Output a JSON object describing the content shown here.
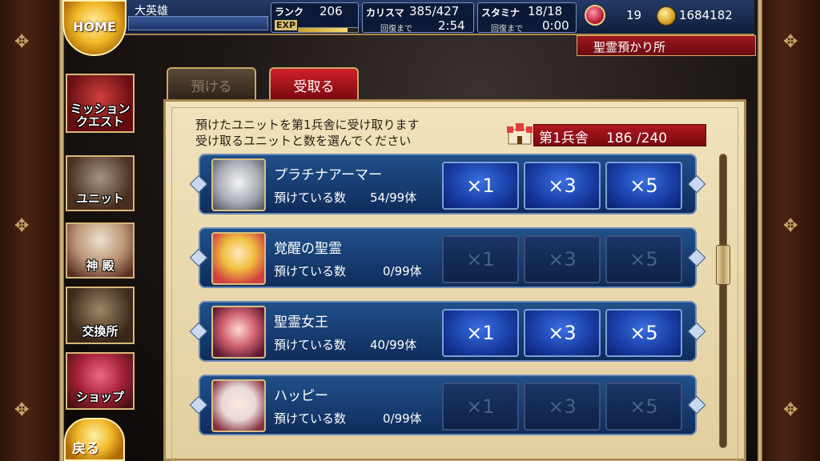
{
  "hud": {
    "player_name": "大英雄",
    "rank_label": "ランク",
    "rank_value": "206",
    "exp_label": "EXP",
    "exp_fraction": 0.82,
    "charisma_label": "カリスマ",
    "charisma_value": "385/427",
    "charisma_recover_label": "回復まで",
    "charisma_recover_time": "2:54",
    "stamina_label": "スタミナ",
    "stamina_value": "18/18",
    "stamina_recover_label": "回復まで",
    "stamina_recover_time": "0:00",
    "gem_count": "19",
    "gold_count": "1684182"
  },
  "location": "聖霊預かり所",
  "home_label": "HOME",
  "side_menu": [
    {
      "label": "ミッション\nクエスト",
      "icon": "crossed-swords-icon"
    },
    {
      "label": "ユニット",
      "icon": "knight-icon"
    },
    {
      "label": "神 殿",
      "icon": "goddess-icon"
    },
    {
      "label": "交換所",
      "icon": "scales-icon"
    },
    {
      "label": "ショップ",
      "icon": "crystal-icon"
    }
  ],
  "back_label": "戻る",
  "tabs": {
    "deposit": "預ける",
    "receive": "受取る"
  },
  "instructions": {
    "line1": "預けたユニットを第1兵舎に受け取ります",
    "line2": "受け取るユニットと数を選んでください"
  },
  "barracks": {
    "label": "第1兵舎",
    "capacity": "186 /240"
  },
  "units": [
    {
      "name": "プラチナアーマー",
      "count_label": "預けている数",
      "count": "54/99体",
      "buttons_enabled": true
    },
    {
      "name": "覚醒の聖霊",
      "count_label": "預けている数",
      "count": "0/99体",
      "buttons_enabled": false
    },
    {
      "name": "聖霊女王",
      "count_label": "預けている数",
      "count": "40/99体",
      "buttons_enabled": true
    },
    {
      "name": "ハッピー",
      "count_label": "預けている数",
      "count": "0/99体",
      "buttons_enabled": false
    }
  ],
  "multipliers": [
    "×1",
    "×3",
    "×5"
  ],
  "colors": {
    "accent_red": "#b01820",
    "button_blue": "#1a40a8",
    "panel_parchment": "#e8d8ae",
    "gold": "#d8b060"
  }
}
